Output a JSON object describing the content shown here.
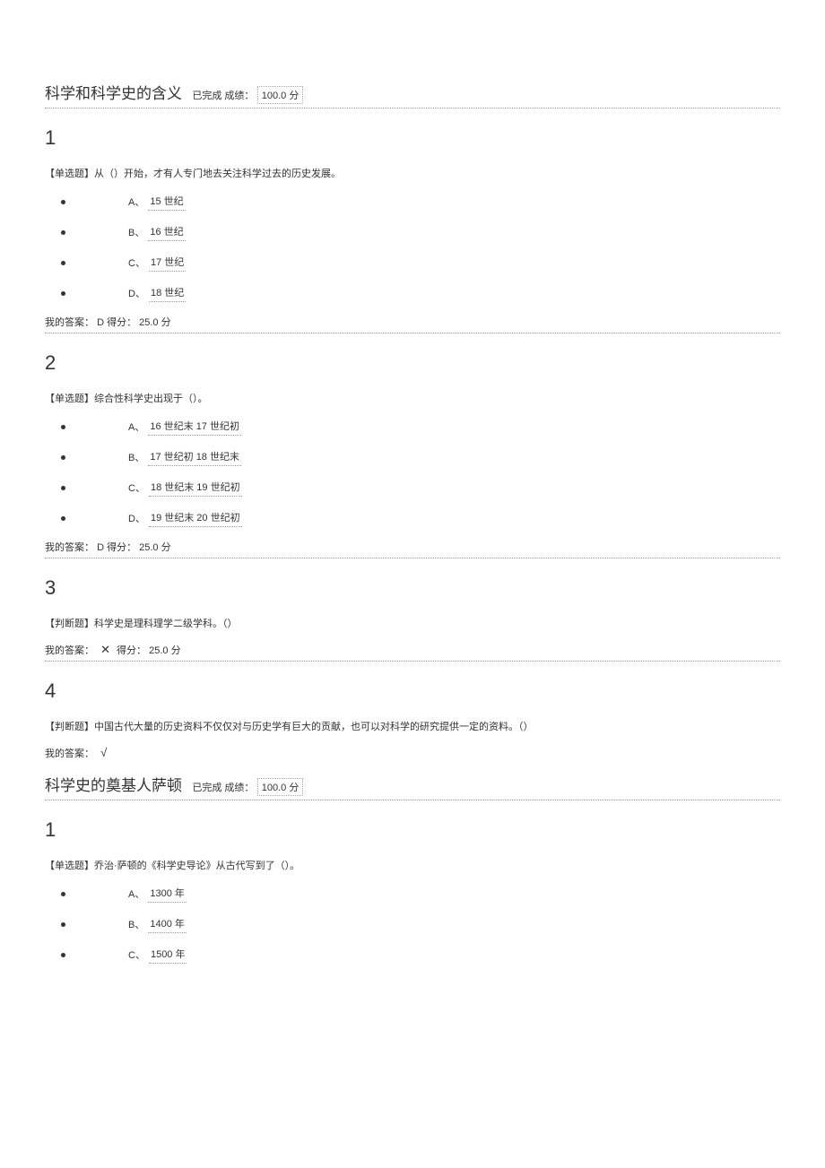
{
  "sections": [
    {
      "title": "科学和科学史的含义",
      "status": "已完成 成绩：",
      "score_value": "100.0",
      "score_unit": "分",
      "questions": [
        {
          "num": "1",
          "prompt": "【单选题】从（）开始，才有人专门地去关注科学过去的历史发展。",
          "options": [
            {
              "letter": "A、",
              "text": "15 世纪"
            },
            {
              "letter": "B、",
              "text": "16 世纪"
            },
            {
              "letter": "C、",
              "text": "17 世纪"
            },
            {
              "letter": "D、",
              "text": "18 世纪"
            }
          ],
          "answer_prefix": "我的答案：",
          "answer_value": "D",
          "answer_score_label": "得分：",
          "answer_score": "25.0",
          "answer_score_unit": "分"
        },
        {
          "num": "2",
          "prompt": "【单选题】综合性科学史出现于（）。",
          "options": [
            {
              "letter": "A、",
              "text": "16 世纪末 17 世纪初"
            },
            {
              "letter": "B、",
              "text": "17 世纪初 18 世纪末"
            },
            {
              "letter": "C、",
              "text": "18 世纪末 19 世纪初"
            },
            {
              "letter": "D、",
              "text": "19 世纪末 20 世纪初"
            }
          ],
          "answer_prefix": "我的答案：",
          "answer_value": "D",
          "answer_score_label": "得分：",
          "answer_score": "25.0",
          "answer_score_unit": "分"
        },
        {
          "num": "3",
          "prompt": "【判断题】科学史是理科理学二级学科。（）",
          "answer_prefix": "我的答案：",
          "answer_value": "✕",
          "answer_score_label": "得分：",
          "answer_score": "25.0",
          "answer_score_unit": "分"
        },
        {
          "num": "4",
          "prompt": "【判断题】中国古代大量的历史资料不仅仅对与历史学有巨大的贡献，也可以对科学的研究提供一定的资料。（）",
          "answer_prefix": "我的答案：",
          "answer_value": "√"
        }
      ]
    },
    {
      "title": "科学史的奠基人萨顿",
      "status": "已完成 成绩：",
      "score_value": "100.0",
      "score_unit": "分",
      "questions": [
        {
          "num": "1",
          "prompt": "【单选题】乔治·萨顿的《科学史导论》从古代写到了（）。",
          "options": [
            {
              "letter": "A、",
              "text": "1300 年"
            },
            {
              "letter": "B、",
              "text": "1400 年"
            },
            {
              "letter": "C、",
              "text": "1500 年"
            }
          ]
        }
      ]
    }
  ]
}
